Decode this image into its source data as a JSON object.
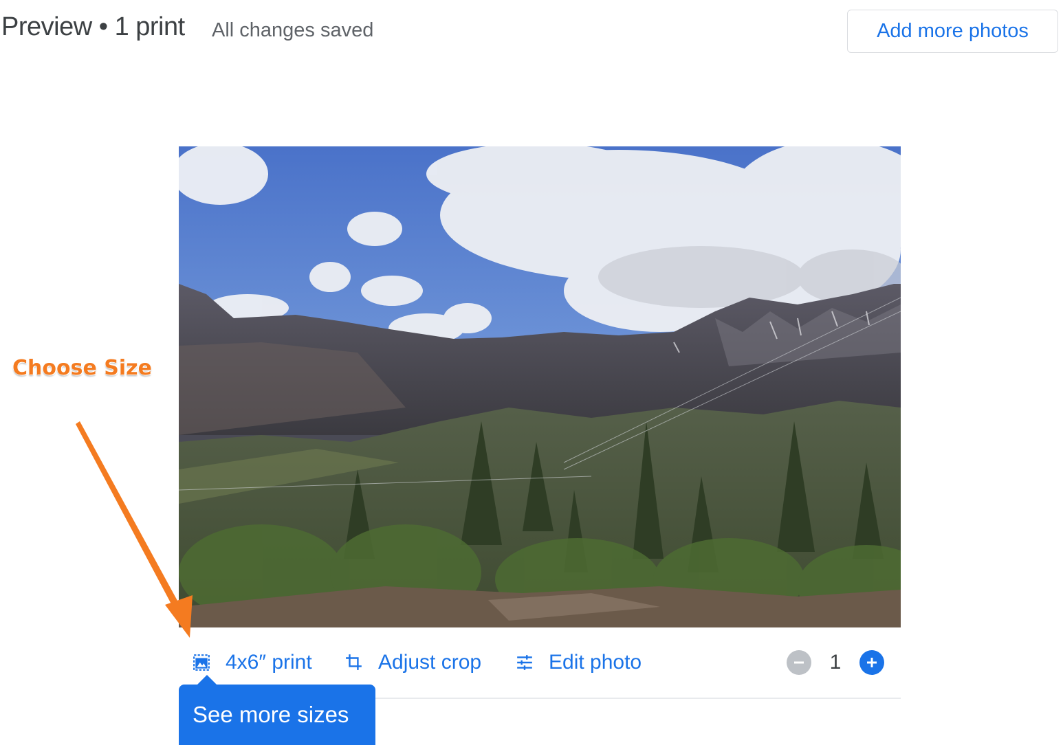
{
  "header": {
    "title": "Preview • 1 print",
    "status": "All changes saved",
    "add_button_label": "Add more photos"
  },
  "toolbar": {
    "size_label": "4x6″ print",
    "crop_label": "Adjust crop",
    "edit_label": "Edit photo",
    "quantity": "1"
  },
  "tooltip": {
    "text": "See more sizes"
  },
  "annotation": {
    "text": "Choose Size",
    "color": "#f47b20"
  },
  "icons": {
    "size": "photo-size-icon",
    "crop": "crop-icon",
    "edit": "tune-icon",
    "minus": "minus-circle-icon",
    "plus": "plus-circle-icon"
  },
  "colors": {
    "accent": "#1a73e8",
    "text": "#3c4043",
    "muted": "#5f6368"
  }
}
